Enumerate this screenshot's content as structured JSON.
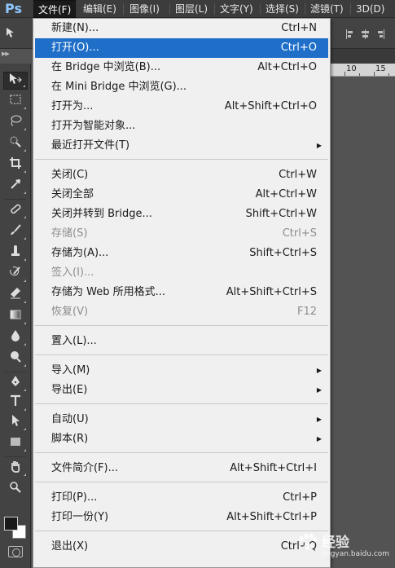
{
  "app": {
    "logo_text": "Ps"
  },
  "menubar": {
    "items": [
      {
        "label": "文件(F)"
      },
      {
        "label": "编辑(E)"
      },
      {
        "label": "图像(I)"
      },
      {
        "label": "图层(L)"
      },
      {
        "label": "文字(Y)"
      },
      {
        "label": "选择(S)"
      },
      {
        "label": "滤镜(T)"
      },
      {
        "label": "3D(D)"
      }
    ]
  },
  "ruler": {
    "labels": [
      "10",
      "15"
    ]
  },
  "file_menu": {
    "items": [
      {
        "label": "新建(N)...",
        "shortcut": "Ctrl+N"
      },
      {
        "label": "打开(O)...",
        "shortcut": "Ctrl+O"
      },
      {
        "label": "在 Bridge 中浏览(B)...",
        "shortcut": "Alt+Ctrl+O"
      },
      {
        "label": "在 Mini Bridge 中浏览(G)...",
        "shortcut": ""
      },
      {
        "label": "打开为...",
        "shortcut": "Alt+Shift+Ctrl+O"
      },
      {
        "label": "打开为智能对象...",
        "shortcut": ""
      },
      {
        "label": "最近打开文件(T)",
        "shortcut": ""
      },
      {
        "label": "关闭(C)",
        "shortcut": "Ctrl+W"
      },
      {
        "label": "关闭全部",
        "shortcut": "Alt+Ctrl+W"
      },
      {
        "label": "关闭并转到 Bridge...",
        "shortcut": "Shift+Ctrl+W"
      },
      {
        "label": "存储(S)",
        "shortcut": "Ctrl+S"
      },
      {
        "label": "存储为(A)...",
        "shortcut": "Shift+Ctrl+S"
      },
      {
        "label": "签入(I)...",
        "shortcut": ""
      },
      {
        "label": "存储为 Web 所用格式...",
        "shortcut": "Alt+Shift+Ctrl+S"
      },
      {
        "label": "恢复(V)",
        "shortcut": "F12"
      },
      {
        "label": "置入(L)...",
        "shortcut": ""
      },
      {
        "label": "导入(M)",
        "shortcut": ""
      },
      {
        "label": "导出(E)",
        "shortcut": ""
      },
      {
        "label": "自动(U)",
        "shortcut": ""
      },
      {
        "label": "脚本(R)",
        "shortcut": ""
      },
      {
        "label": "文件简介(F)...",
        "shortcut": "Alt+Shift+Ctrl+I"
      },
      {
        "label": "打印(P)...",
        "shortcut": "Ctrl+P"
      },
      {
        "label": "打印一份(Y)",
        "shortcut": "Alt+Shift+Ctrl+P"
      },
      {
        "label": "退出(X)",
        "shortcut": "Ctrl+Q"
      }
    ]
  },
  "watermark": {
    "text": "经验",
    "sub": "jingyan.baidu.com"
  },
  "colors": {
    "highlight": "#1f6fc9",
    "menu_bg": "#f0f0f0",
    "workspace": "#535353"
  }
}
